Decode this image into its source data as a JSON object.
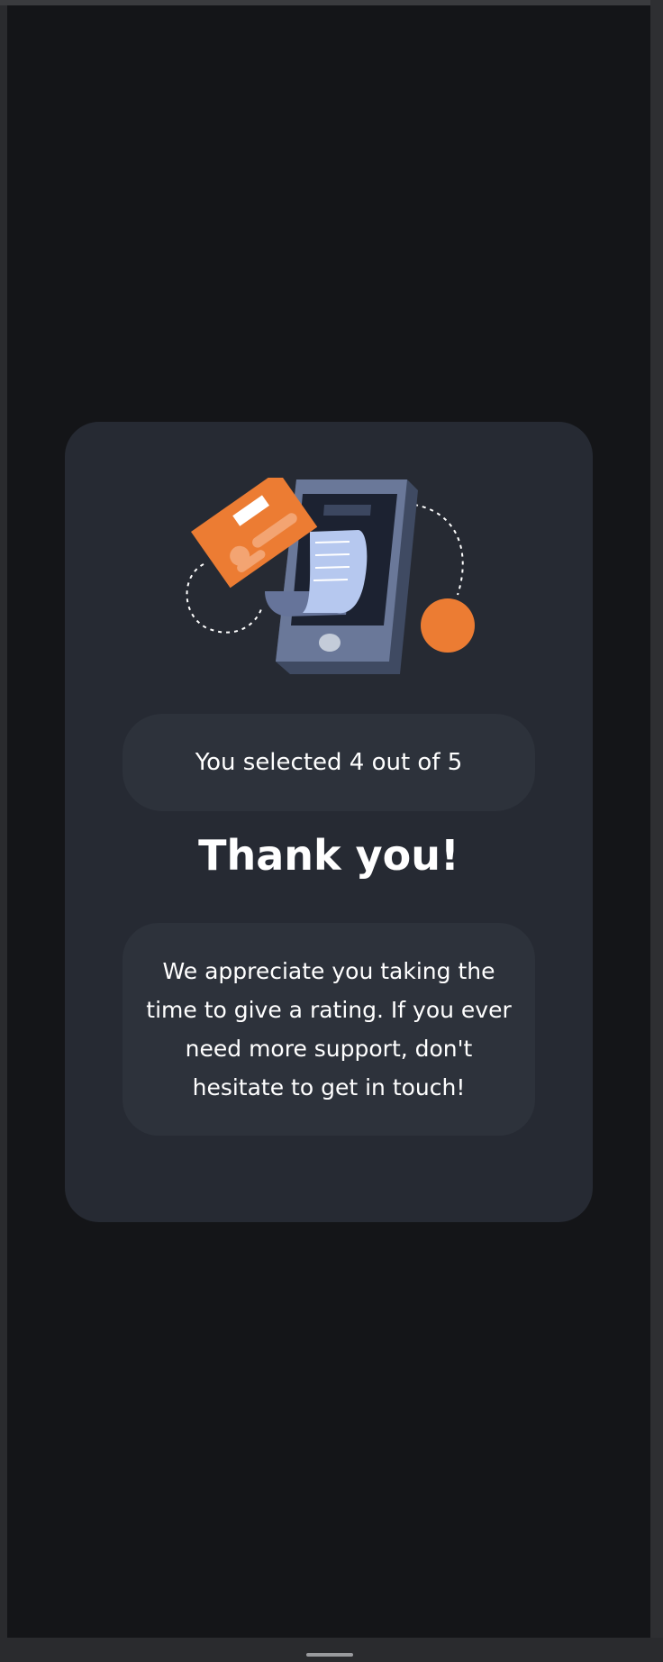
{
  "rating": {
    "selected_text": "You selected 4 out of 5",
    "value": 4,
    "max": 5
  },
  "title": "Thank you!",
  "message": "We appreciate you taking the time to give a rating. If you ever need more support, don't hesitate to get in touch!",
  "colors": {
    "background": "#141518",
    "card": "#262a33",
    "pill": "#2d323b",
    "accent_orange": "#ec7c33",
    "text": "#ffffff"
  },
  "illustration": {
    "icon": "phone-payment-illustration"
  }
}
